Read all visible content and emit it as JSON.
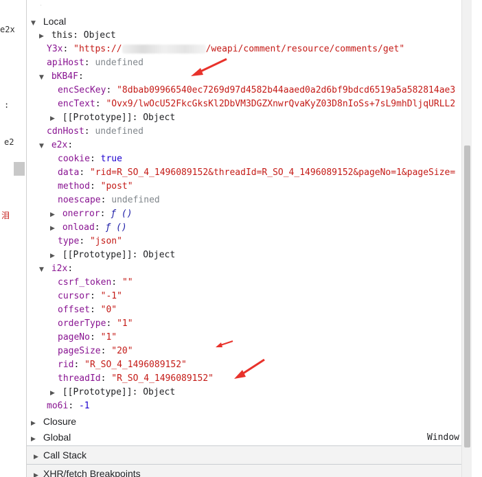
{
  "left_fragments": [
    "e2x",
    ":",
    "e2",
    "泪"
  ],
  "scope": {
    "local_label": "Local",
    "this": {
      "key": "this",
      "value": "Object"
    },
    "y3x": {
      "key": "Y3x",
      "value_prefix": "\"https://",
      "value_suffix": "/weapi/comment/resource/comments/get\""
    },
    "apiHost": {
      "key": "apiHost",
      "value": "undefined"
    },
    "bKB4F": {
      "key": "bKB4F",
      "encSecKey": {
        "key": "encSecKey",
        "value": "\"8dbab09966540ec7269d97d4582b44aaed0a2d6bf9bdcd6519a5a582814ae3"
      },
      "encText": {
        "key": "encText",
        "value": "\"Ovx9/lwOcU52FkcGksKl2DbVM3DGZXnwrQvaKyZ03D8nIoSs+7sL9mhDljqURLL2"
      },
      "proto": {
        "key": "[[Prototype]]",
        "value": "Object"
      }
    },
    "cdnHost": {
      "key": "cdnHost",
      "value": "undefined"
    },
    "e2x": {
      "key": "e2x",
      "cookie": {
        "key": "cookie",
        "value": "true"
      },
      "data": {
        "key": "data",
        "value": "\"rid=R_SO_4_1496089152&threadId=R_SO_4_1496089152&pageNo=1&pageSize="
      },
      "method": {
        "key": "method",
        "value": "\"post\""
      },
      "noescape": {
        "key": "noescape",
        "value": "undefined"
      },
      "onerror": {
        "key": "onerror",
        "value": "ƒ ()"
      },
      "onload": {
        "key": "onload",
        "value": "ƒ ()"
      },
      "type": {
        "key": "type",
        "value": "\"json\""
      },
      "proto": {
        "key": "[[Prototype]]",
        "value": "Object"
      }
    },
    "i2x": {
      "key": "i2x",
      "csrf_token": {
        "key": "csrf_token",
        "value": "\"\""
      },
      "cursor": {
        "key": "cursor",
        "value": "\"-1\""
      },
      "offset": {
        "key": "offset",
        "value": "\"0\""
      },
      "orderType": {
        "key": "orderType",
        "value": "\"1\""
      },
      "pageNo": {
        "key": "pageNo",
        "value": "\"1\""
      },
      "pageSize": {
        "key": "pageSize",
        "value": "\"20\""
      },
      "rid": {
        "key": "rid",
        "value": "\"R_SO_4_1496089152\""
      },
      "threadId": {
        "key": "threadId",
        "value": "\"R_SO_4_1496089152\""
      },
      "proto": {
        "key": "[[Prototype]]",
        "value": "Object"
      }
    },
    "mo6i": {
      "key": "mo6i",
      "value": "-1"
    },
    "closure_label": "Closure",
    "global_label": "Global",
    "global_value": "Window"
  },
  "sections": {
    "call_stack": "Call Stack",
    "xhr_breakpoints": "XHR/fetch Breakpoints"
  },
  "colors": {
    "key": "#881391",
    "string": "#c41a16",
    "number": "#1c00cf",
    "undefined": "#80868b",
    "annotation_arrow": "#e8322b"
  }
}
